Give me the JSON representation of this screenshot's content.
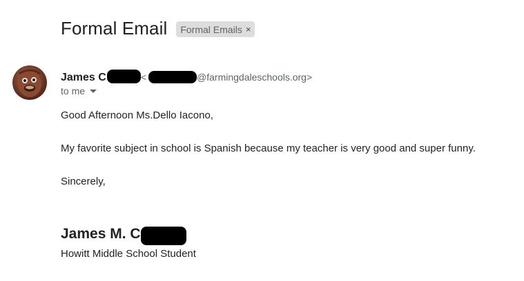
{
  "email": {
    "subject": "Formal Email",
    "label": {
      "text": "Formal Emails",
      "close_glyph": "×"
    },
    "sender": {
      "name_visible": "James C",
      "email_open": "<",
      "email_domain": "@farmingdaleschools.org>",
      "avatar_icon": "user-avatar-photo"
    },
    "recipient": {
      "text": "to me",
      "dropdown_icon": "caret-down-icon"
    },
    "body": {
      "greeting": "Good Afternoon Ms.Dello Iacono,",
      "paragraph": "My favorite subject in school is Spanish because my teacher is very good and super funny.",
      "closing": "Sincerely,"
    },
    "signature": {
      "name_visible": "James M. C",
      "title": "Howitt Middle School Student"
    }
  },
  "colors": {
    "chip_bg": "#dddddd",
    "secondary_text": "#5f6368",
    "redaction": "#000000"
  }
}
